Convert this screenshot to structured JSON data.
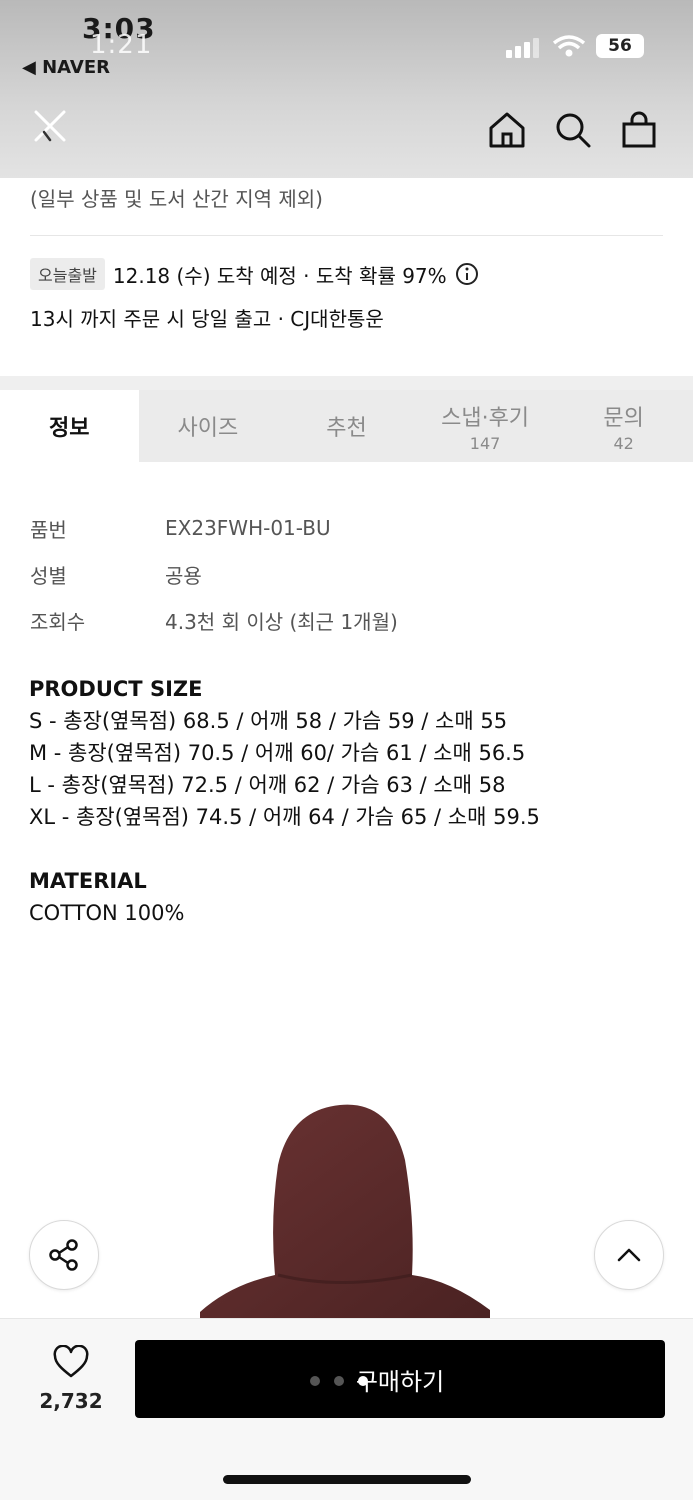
{
  "status": {
    "time": "3:03",
    "time_overlay": "1:21",
    "battery": "56",
    "back_app": "◀ NAVER"
  },
  "nav": {
    "close_icon": "close-icon",
    "icons": [
      "home-icon",
      "search-icon",
      "bag-icon"
    ]
  },
  "delivery": {
    "exclude_note": "(일부 상품 및 도서 산간 지역 제외)",
    "badge": "오늘출발",
    "arrival": "12.18 (수) 도착 예정 · 도착 확률 97%",
    "line2": "13시 까지 주문 시 당일 출고 · CJ대한통운"
  },
  "tabs": [
    {
      "label": "정보",
      "count": ""
    },
    {
      "label": "사이즈",
      "count": ""
    },
    {
      "label": "추천",
      "count": ""
    },
    {
      "label": "스냅·후기",
      "count": "147"
    },
    {
      "label": "문의",
      "count": "42"
    }
  ],
  "details": [
    {
      "key": "품번",
      "value": "EX23FWH-01-BU"
    },
    {
      "key": "성별",
      "value": "공용"
    },
    {
      "key": "조회수",
      "value": "4.3천 회 이상 (최근 1개월)"
    }
  ],
  "product_size": {
    "title": "PRODUCT SIZE",
    "lines": [
      "S - 총장(옆목점) 68.5 / 어깨 58 / 가슴 59 / 소매 55",
      "M - 총장(옆목점) 70.5 / 어깨 60/ 가슴 61 / 소매 56.5",
      "L - 총장(옆목점) 72.5 / 어깨 62 / 가슴 63 / 소매 58",
      "XL - 총장(옆목점) 74.5 / 어깨 64 / 가슴 65 / 소매 59.5"
    ]
  },
  "material": {
    "title": "MATERIAL",
    "value": "COTTON 100%"
  },
  "colors": {
    "hoodie": "#5a2a2a",
    "accent": "#000000"
  },
  "bottom": {
    "like_count": "2,732",
    "buy_label": "구매하기"
  }
}
